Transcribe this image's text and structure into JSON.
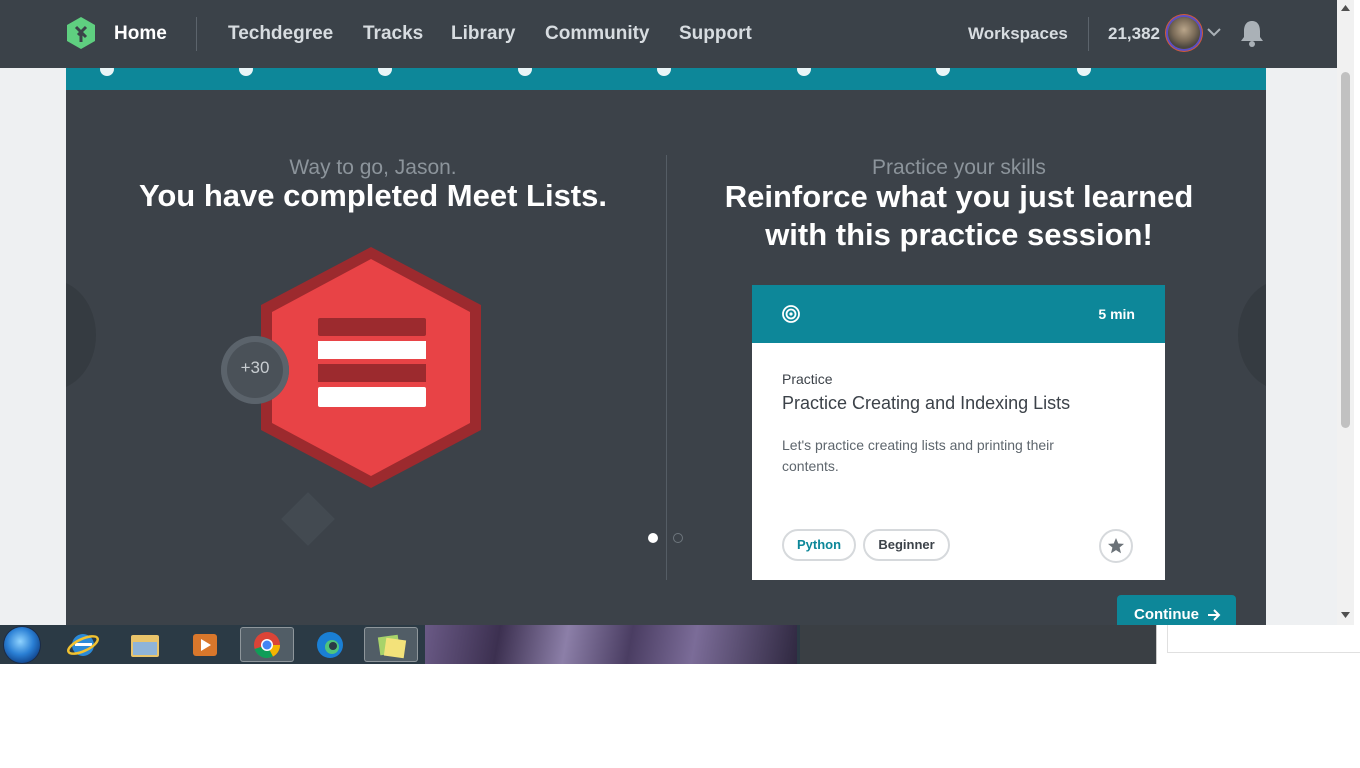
{
  "nav": {
    "home": "Home",
    "links": [
      "Techdegree",
      "Tracks",
      "Library",
      "Community",
      "Support"
    ],
    "workspaces": "Workspaces",
    "points": "21,382"
  },
  "completion": {
    "greeting": "Way to go, Jason.",
    "headline": "You have completed Meet Lists.",
    "points_earned": "+30"
  },
  "practice": {
    "subtitle": "Practice your skills",
    "headline_line1": "Reinforce what you just learned",
    "headline_line2": "with this practice session!"
  },
  "card": {
    "duration": "5 min",
    "kind": "Practice",
    "title": "Practice Creating and Indexing Lists",
    "description": "Let's practice creating lists and printing their contents.",
    "tags": [
      "Python",
      "Beginner"
    ]
  },
  "actions": {
    "continue": "Continue"
  },
  "colors": {
    "teal": "#0d8799",
    "nav_bg": "#3b4249",
    "panel_bg": "#3c4249",
    "badge_red": "#e84346",
    "badge_dark": "#9c2a2e"
  },
  "pager": {
    "count": 2,
    "active": 1
  },
  "icons": [
    "treehouse-logo-icon",
    "chevron-down-icon",
    "bell-icon",
    "target-icon",
    "star-icon",
    "arrow-right-icon",
    "lists-badge-icon"
  ],
  "taskbar_apps": [
    "start-orb",
    "internet-explorer",
    "file-explorer",
    "media-player",
    "google-chrome",
    "microsoft-edge",
    "sticky-notes"
  ]
}
